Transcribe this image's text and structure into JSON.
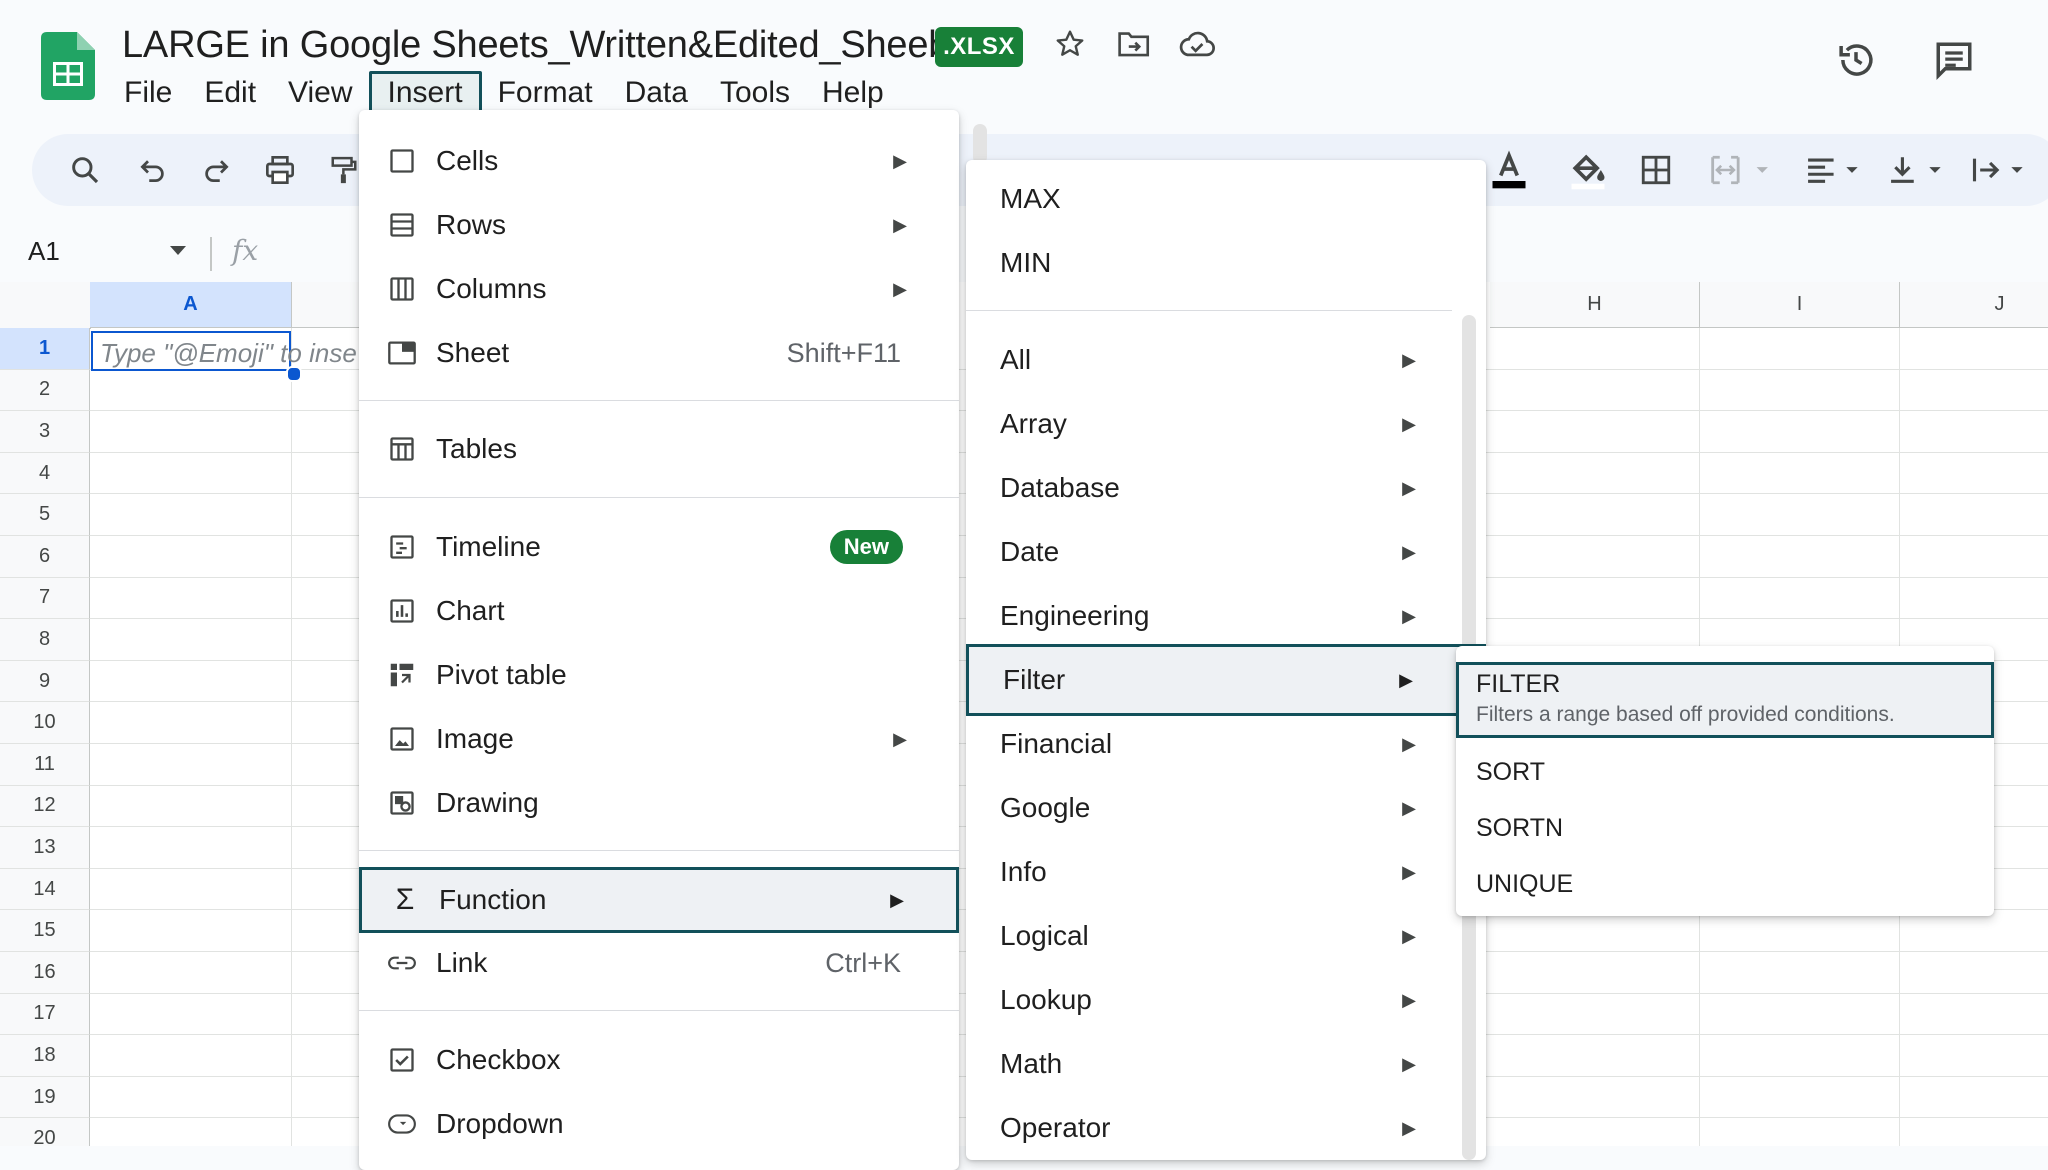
{
  "header": {
    "title": "LARGE in Google Sheets_Written&Edited_Sheeba",
    "file_badge": ".XLSX",
    "icons": [
      "star-icon",
      "move-to-folder-icon",
      "cloud-saved-icon",
      "version-history-icon",
      "comments-icon"
    ]
  },
  "menubar": [
    "File",
    "Edit",
    "View",
    "Insert",
    "Format",
    "Data",
    "Tools",
    "Help"
  ],
  "menubar_active": "Insert",
  "toolbar": {
    "icons": [
      "search-icon",
      "undo-icon",
      "redo-icon",
      "print-icon",
      "paint-format-icon",
      "text-color-icon",
      "fill-color-icon",
      "borders-icon",
      "merge-cells-icon",
      "horizontal-align-icon",
      "vertical-align-icon",
      "text-wrapping-icon"
    ]
  },
  "formula_bar": {
    "name_box": "A1",
    "fx": "fx"
  },
  "grid": {
    "columns_left": [
      "A"
    ],
    "columns_right": [
      "H",
      "I",
      "J"
    ],
    "rows": [
      "1",
      "2",
      "3",
      "4",
      "5",
      "6",
      "7",
      "8",
      "9",
      "10",
      "11",
      "12",
      "13",
      "14",
      "15",
      "16",
      "17",
      "18",
      "19",
      "20"
    ],
    "selected_cell_placeholder": "Type \"@Emoji\" to inse"
  },
  "insert_menu": {
    "items": [
      {
        "label": "Cells",
        "icon": "cells-icon",
        "submenu": true
      },
      {
        "label": "Rows",
        "icon": "rows-icon",
        "submenu": true
      },
      {
        "label": "Columns",
        "icon": "columns-icon",
        "submenu": true
      },
      {
        "label": "Sheet",
        "icon": "sheet-icon",
        "shortcut": "Shift+F11"
      },
      {
        "label": "Tables",
        "icon": "tables-icon"
      },
      {
        "label": "Timeline",
        "icon": "timeline-icon",
        "badge": "New"
      },
      {
        "label": "Chart",
        "icon": "chart-icon"
      },
      {
        "label": "Pivot table",
        "icon": "pivot-table-icon"
      },
      {
        "label": "Image",
        "icon": "image-icon",
        "submenu": true
      },
      {
        "label": "Drawing",
        "icon": "drawing-icon"
      },
      {
        "label": "Function",
        "icon": "sigma-icon",
        "submenu": true,
        "highlighted": true
      },
      {
        "label": "Link",
        "icon": "link-icon",
        "shortcut": "Ctrl+K"
      },
      {
        "label": "Checkbox",
        "icon": "checkbox-icon"
      },
      {
        "label": "Dropdown",
        "icon": "dropdown-icon"
      }
    ]
  },
  "function_menu": {
    "quick": [
      "MAX",
      "MIN"
    ],
    "categories": [
      "All",
      "Array",
      "Database",
      "Date",
      "Engineering",
      "Filter",
      "Financial",
      "Google",
      "Info",
      "Logical",
      "Lookup",
      "Math",
      "Operator"
    ],
    "highlighted": "Filter"
  },
  "filter_menu": {
    "items": [
      {
        "name": "FILTER",
        "description": "Filters a range based off provided conditions.",
        "highlighted": true
      },
      {
        "name": "SORT"
      },
      {
        "name": "SORTN"
      },
      {
        "name": "UNIQUE"
      }
    ]
  },
  "colors": {
    "accent_outline": "#12505a",
    "badge_green": "#188038",
    "selection_blue": "#0b57d0"
  }
}
